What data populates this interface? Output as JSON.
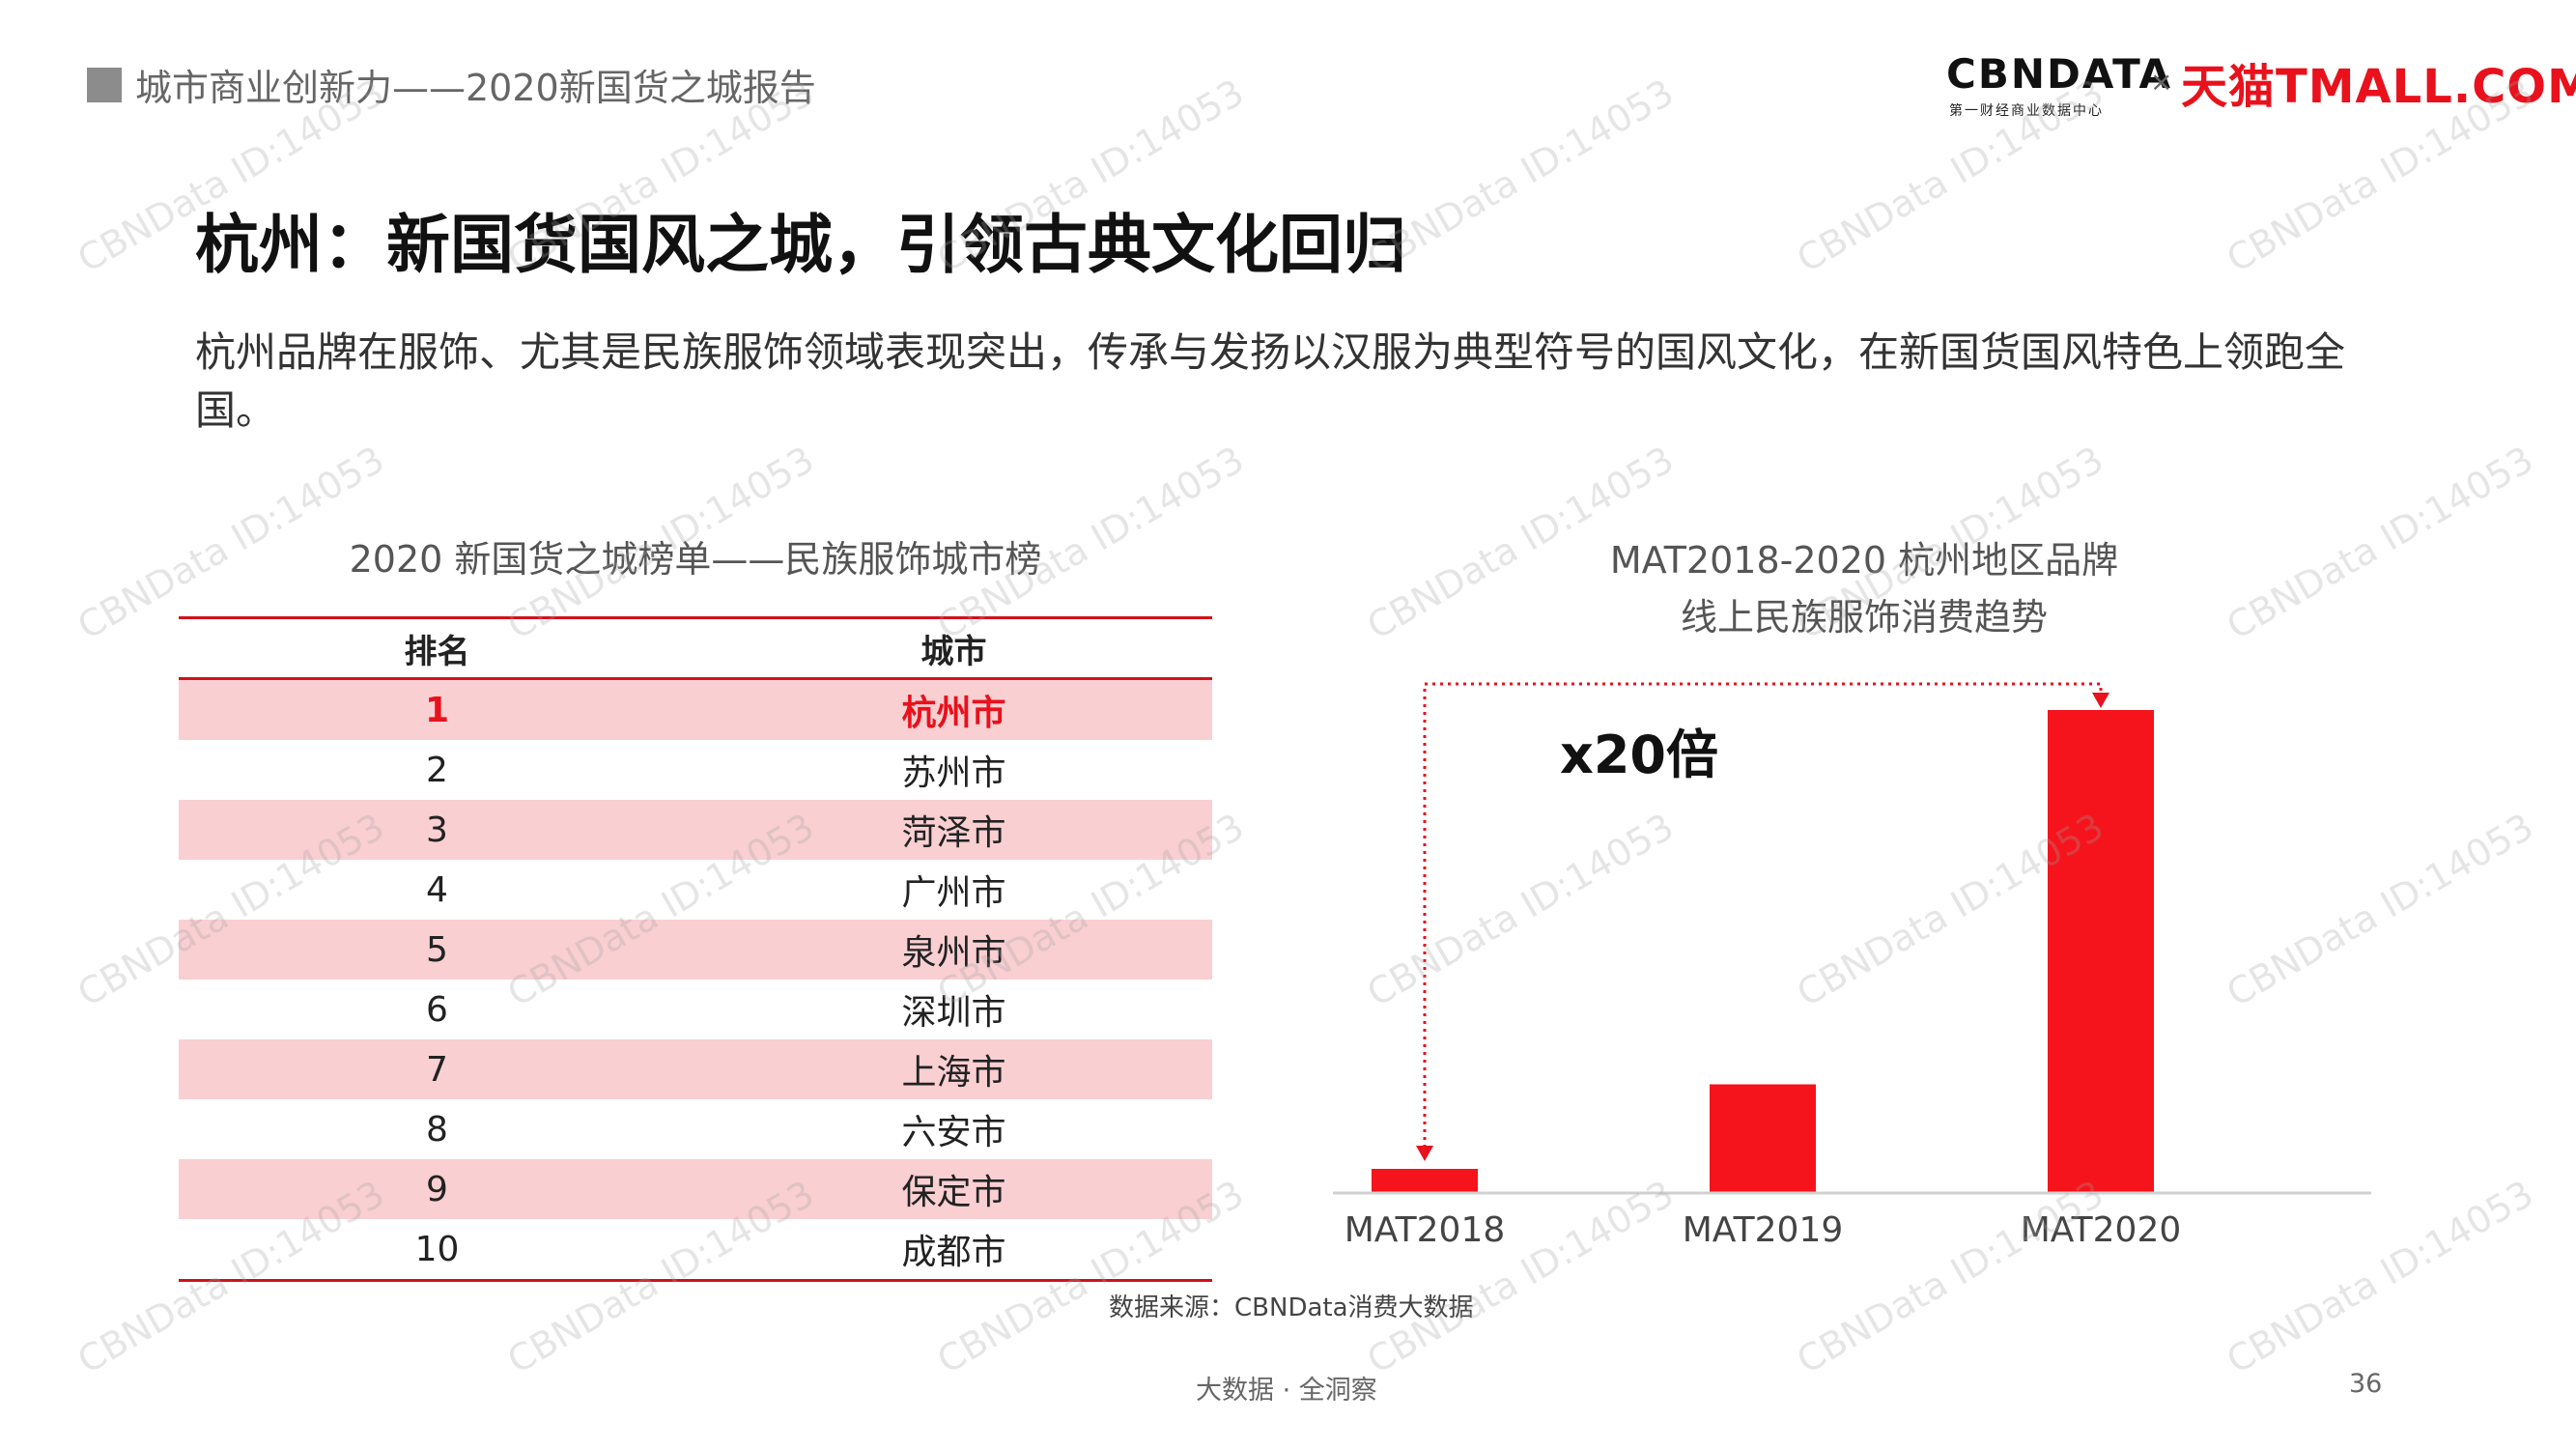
{
  "header": {
    "report_title": "城市商业创新力——2020新国货之城报告",
    "logo_cbn": "CBNDATA",
    "logo_cbn_sub": "第一财经商业数据中心",
    "logo_times": "×",
    "logo_tmall": "天猫TMALL.COM"
  },
  "main": {
    "title": "杭州：新国货国风之城，引领古典文化回归",
    "description": "杭州品牌在服饰、尤其是民族服饰领域表现突出，传承与发扬以汉服为典型符号的国风文化，在新国货国风特色上领跑全国。"
  },
  "table": {
    "title": "2020 新国货之城榜单——民族服饰城市榜",
    "headers": [
      "排名",
      "城市"
    ],
    "rows": [
      {
        "rank": "1",
        "city": "杭州市"
      },
      {
        "rank": "2",
        "city": "苏州市"
      },
      {
        "rank": "3",
        "city": "菏泽市"
      },
      {
        "rank": "4",
        "city": "广州市"
      },
      {
        "rank": "5",
        "city": "泉州市"
      },
      {
        "rank": "6",
        "city": "深圳市"
      },
      {
        "rank": "7",
        "city": "上海市"
      },
      {
        "rank": "8",
        "city": "六安市"
      },
      {
        "rank": "9",
        "city": "保定市"
      },
      {
        "rank": "10",
        "city": "成都市"
      }
    ]
  },
  "chart_data": {
    "type": "bar",
    "title": "MAT2018-2020 杭州地区品牌",
    "subtitle": "线上民族服饰消费趋势",
    "categories": [
      "MAT2018",
      "MAT2019",
      "MAT2020"
    ],
    "values": [
      1,
      4.5,
      20
    ],
    "ylim": [
      0,
      20
    ],
    "grid": false,
    "bar_color": "#f5141c",
    "annotation": "x20倍"
  },
  "source": "数据来源：CBNData消费大数据",
  "footer": {
    "slogan": "大数据 · 全洞察",
    "page_number": "36"
  },
  "watermark": "CBNData ID:14053"
}
